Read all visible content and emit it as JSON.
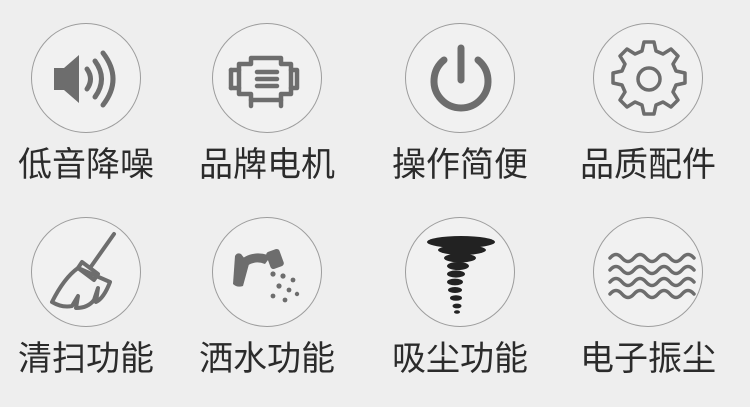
{
  "features": [
    {
      "label": "低音降噪",
      "icon": "speaker-icon"
    },
    {
      "label": "品牌电机",
      "icon": "motor-icon"
    },
    {
      "label": "操作简便",
      "icon": "power-icon"
    },
    {
      "label": "品质配件",
      "icon": "gear-icon"
    },
    {
      "label": "清扫功能",
      "icon": "broom-icon"
    },
    {
      "label": "洒水功能",
      "icon": "watering-can-icon"
    },
    {
      "label": "吸尘功能",
      "icon": "tornado-icon"
    },
    {
      "label": "电子振尘",
      "icon": "waves-icon"
    }
  ],
  "colors": {
    "background": "#eeeeee",
    "icon_gray": "#6d6d6d",
    "circle_border": "#9d9d9d",
    "text": "#2b2b2b"
  }
}
